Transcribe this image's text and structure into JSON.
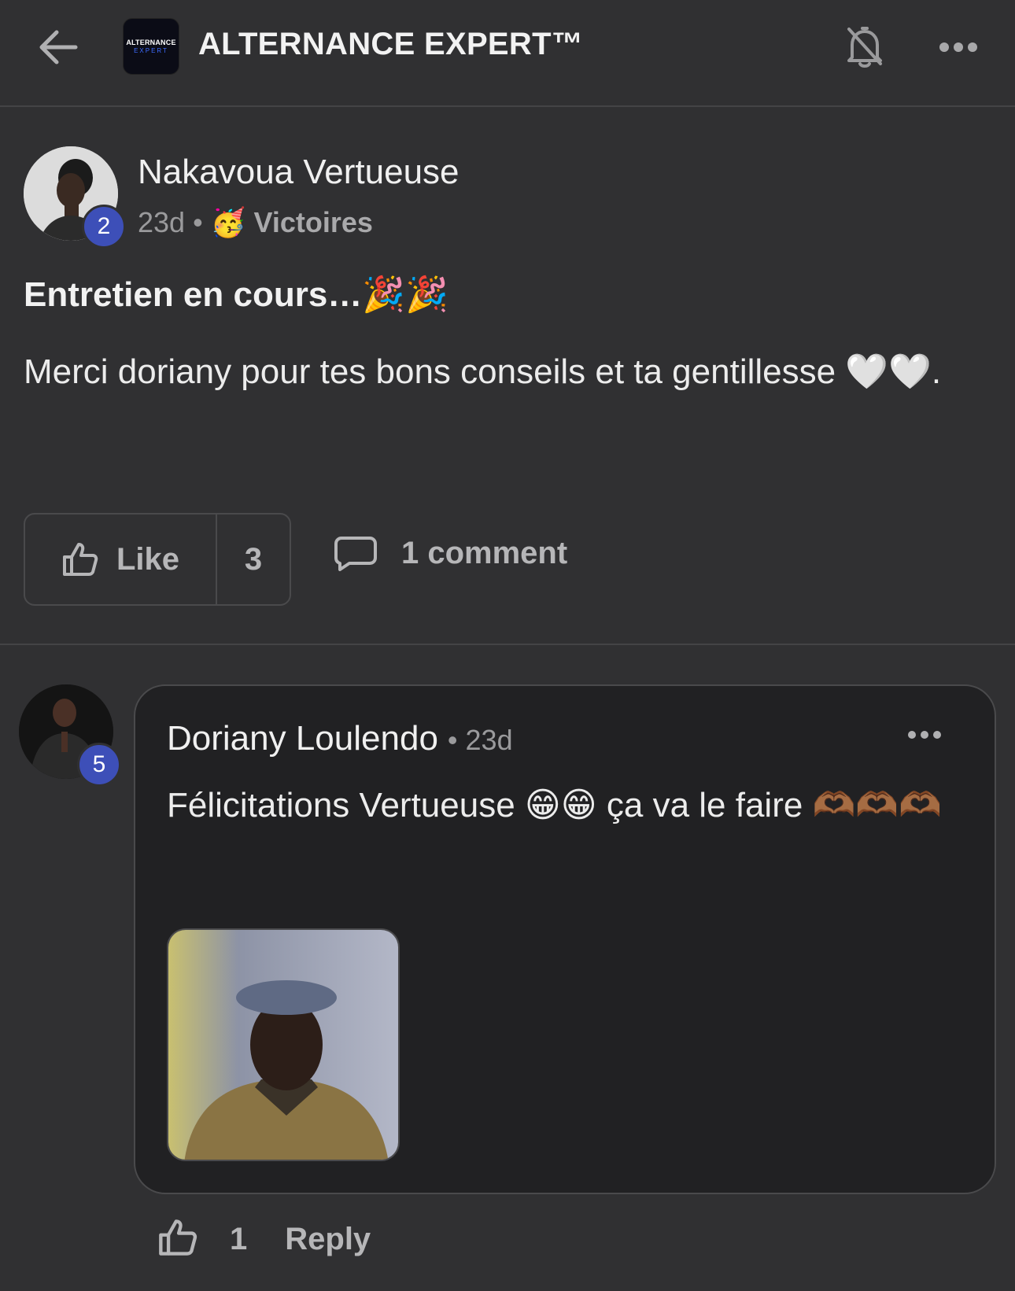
{
  "header": {
    "back_icon": "arrow-left-icon",
    "logo_line1": "ALTERNANCE",
    "logo_line2": "EXPERT",
    "group_title": "ALTERNANCE EXPERT™",
    "bell_icon": "bell-off-icon",
    "more_icon": "more-horizontal-icon"
  },
  "post": {
    "author": "Nakavoua Vertueuse",
    "level": "2",
    "time": "23d",
    "separator": "•",
    "category_emoji": "🥳",
    "category": "Victoires",
    "title": "Entretien en cours…🎉🎉",
    "body": "Merci doriany pour tes bons conseils et ta gentillesse 🤍🤍.",
    "like_label": "Like",
    "like_count": "3",
    "comment_label": "1 comment"
  },
  "comment": {
    "author": "Doriany Loulendo",
    "level": "5",
    "time": "• 23d",
    "text": "Félicitations Vertueuse 😁😁 ça va le faire 🫶🏾🫶🏾🫶🏾",
    "like_count": "1",
    "reply_label": "Reply"
  },
  "colors": {
    "background": "#303032",
    "bubble": "#212123",
    "badge": "#3d4fb8",
    "muted_text": "#9a9a9c"
  }
}
